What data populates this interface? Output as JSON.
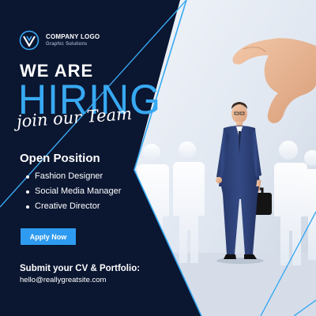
{
  "logo": {
    "icon": "company-logo-mark",
    "name": "COMPANY LOGO",
    "tagline": "Graphic Solutions"
  },
  "headline": {
    "we_are": "WE ARE",
    "hiring": "HIRING",
    "script": "join our Team"
  },
  "positions": {
    "title": "Open Position",
    "items": [
      "Fashion Designer",
      "Social Media Manager",
      "Creative Director"
    ]
  },
  "cta": {
    "label": "Apply Now"
  },
  "contact": {
    "prompt": "Submit your CV & Portfolio:",
    "email": "hello@reallygreatsite.com"
  },
  "colors": {
    "background": "#0b1631",
    "accent": "#38a9f2",
    "button": "#2f9bf0",
    "text": "#ffffff"
  }
}
